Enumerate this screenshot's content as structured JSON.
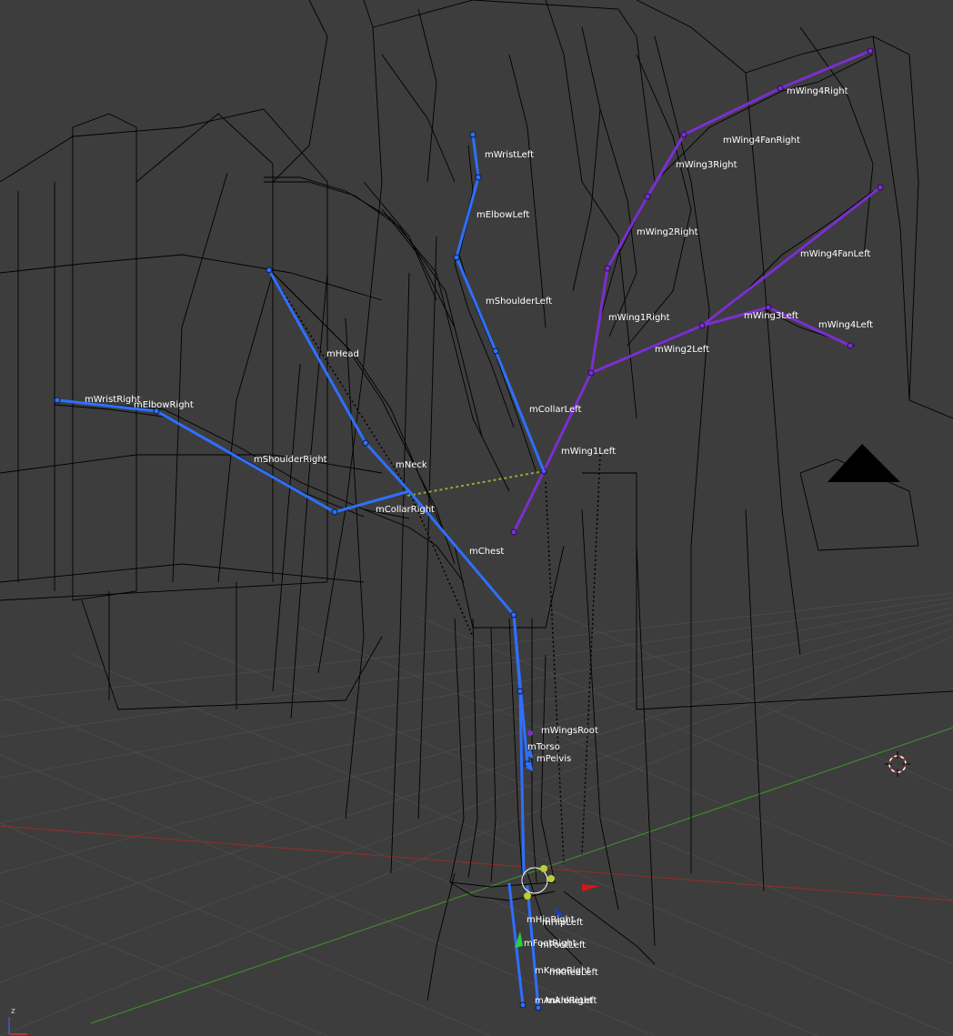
{
  "viewport": {
    "colors": {
      "background": "#3d3d3d",
      "grid": "#4a4a4a",
      "wire": "#000000",
      "x_axis": "#8a2e2e",
      "y_axis": "#3f8a2e",
      "bone_blue": "#2f6fff",
      "bone_purple": "#7a2fd0",
      "bone_outline": "#0b1a40"
    },
    "axis_indicator": {
      "z_label": "z"
    },
    "bones": [
      {
        "name": "mWristLeft"
      },
      {
        "name": "mElbowLeft"
      },
      {
        "name": "mShoulderLeft"
      },
      {
        "name": "mCollarLeft"
      },
      {
        "name": "mHead"
      },
      {
        "name": "mNeck"
      },
      {
        "name": "mWristRight"
      },
      {
        "name": "mElbowRight"
      },
      {
        "name": "mShoulderRight"
      },
      {
        "name": "mCollarRight"
      },
      {
        "name": "mChest"
      },
      {
        "name": "mWing4Right"
      },
      {
        "name": "mWing4FanRight"
      },
      {
        "name": "mWing3Right"
      },
      {
        "name": "mWing2Right"
      },
      {
        "name": "mWing1Right"
      },
      {
        "name": "mWing4FanLeft"
      },
      {
        "name": "mWing3Left"
      },
      {
        "name": "mWing4Left"
      },
      {
        "name": "mWing2Left"
      },
      {
        "name": "mWing1Left"
      },
      {
        "name": "mWingsRoot"
      },
      {
        "name": "mTorso"
      },
      {
        "name": "mPelvis"
      },
      {
        "name": "mHipRight"
      },
      {
        "name": "mHipLeft"
      },
      {
        "name": "mFootRight"
      },
      {
        "name": "mFootLeft"
      },
      {
        "name": "mKneeRight"
      },
      {
        "name": "mKneeLeft"
      },
      {
        "name": "mAnkleRight"
      },
      {
        "name": "mAnkleLeft"
      }
    ]
  }
}
